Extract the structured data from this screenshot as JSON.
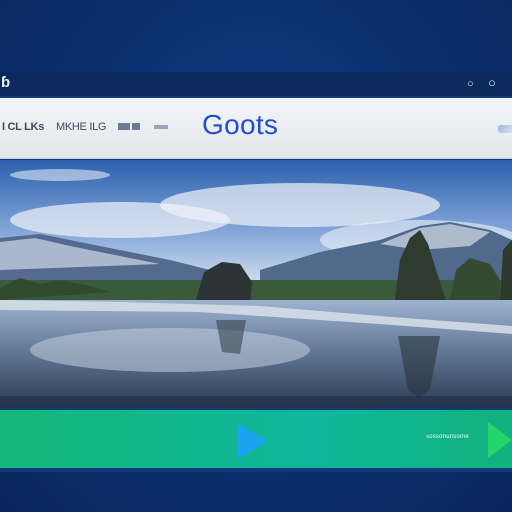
{
  "titlebar": {
    "left_icon": "app-logo-icon",
    "right_icons": [
      "small-circle-icon",
      "large-circle-icon"
    ]
  },
  "header": {
    "nav_items": [
      "I CL LKs",
      "MKHE ILG"
    ],
    "brand": "Goots"
  },
  "hero": {
    "subject": "landscape-image"
  },
  "player": {
    "caption": "sossonunsome",
    "play_icon": "play-icon",
    "next_icon": "next-icon",
    "accent": "#14b778",
    "play_color": "#1aa4f0"
  }
}
